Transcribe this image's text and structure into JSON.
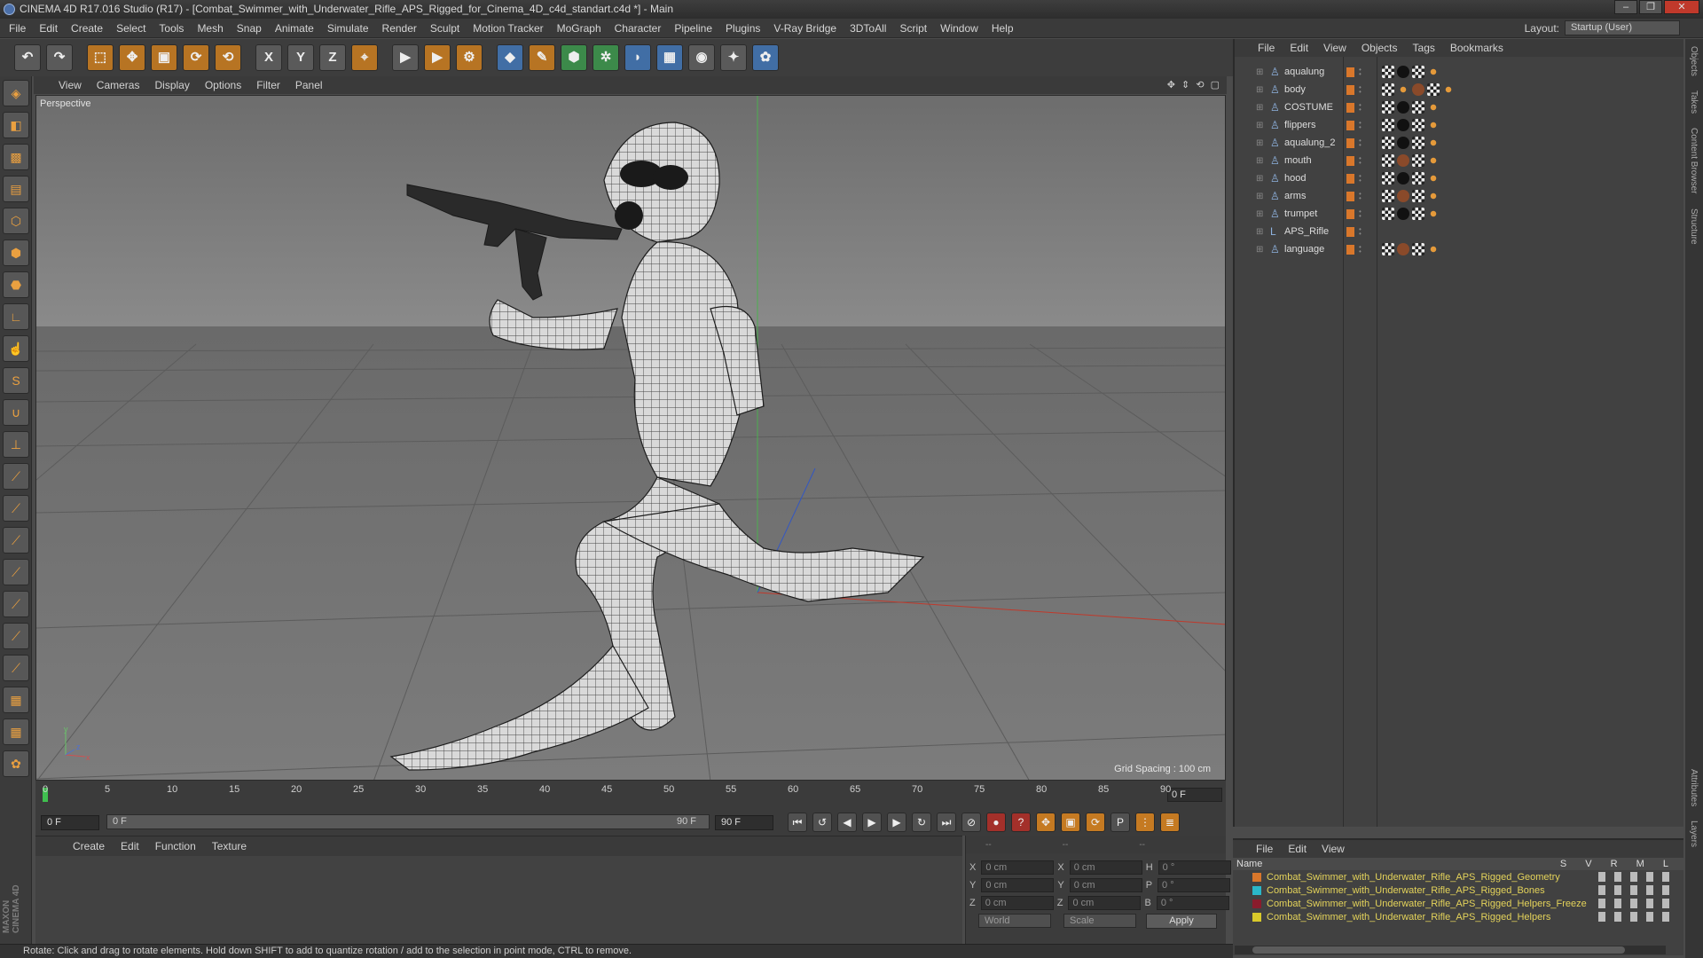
{
  "window": {
    "title": "CINEMA 4D R17.016 Studio (R17) - [Combat_Swimmer_with_Underwater_Rifle_APS_Rigged_for_Cinema_4D_c4d_standart.c4d *] - Main",
    "buttons": [
      "–",
      "❐",
      "✕"
    ]
  },
  "menubar": [
    "File",
    "Edit",
    "Create",
    "Select",
    "Tools",
    "Mesh",
    "Snap",
    "Animate",
    "Simulate",
    "Render",
    "Sculpt",
    "Motion Tracker",
    "MoGraph",
    "Character",
    "Pipeline",
    "Plugins",
    "V-Ray Bridge",
    "3DToAll",
    "Script",
    "Window",
    "Help"
  ],
  "layout": {
    "label": "Layout:",
    "value": "Startup (User)"
  },
  "toolbar": {
    "icons": [
      {
        "name": "undo-icon",
        "glyph": "↶",
        "cls": ""
      },
      {
        "name": "redo-icon",
        "glyph": "↷",
        "cls": ""
      },
      {
        "name": "live-selection-icon",
        "glyph": "⬚",
        "cls": "o sep"
      },
      {
        "name": "move-icon",
        "glyph": "✥",
        "cls": "o"
      },
      {
        "name": "scale-icon",
        "glyph": "▣",
        "cls": "o"
      },
      {
        "name": "rotate-icon",
        "glyph": "⟳",
        "cls": "o"
      },
      {
        "name": "recent-tool-icon",
        "glyph": "⟲",
        "cls": "o"
      },
      {
        "name": "x-axis-icon",
        "glyph": "X",
        "cls": "sep"
      },
      {
        "name": "y-axis-icon",
        "glyph": "Y",
        "cls": ""
      },
      {
        "name": "z-axis-icon",
        "glyph": "Z",
        "cls": ""
      },
      {
        "name": "coordinate-system-icon",
        "glyph": "⌖",
        "cls": "o"
      },
      {
        "name": "render-view-icon",
        "glyph": "▶",
        "cls": "sep"
      },
      {
        "name": "render-picture-viewer-icon",
        "glyph": "▶",
        "cls": "o"
      },
      {
        "name": "render-settings-icon",
        "glyph": "⚙",
        "cls": "o"
      },
      {
        "name": "cube-icon",
        "glyph": "◆",
        "cls": "b sep"
      },
      {
        "name": "pen-spline-icon",
        "glyph": "✎",
        "cls": "o"
      },
      {
        "name": "subdivision-icon",
        "glyph": "⬢",
        "cls": "g"
      },
      {
        "name": "array-icon",
        "glyph": "✲",
        "cls": "g"
      },
      {
        "name": "deformer-icon",
        "glyph": "◗",
        "cls": "b"
      },
      {
        "name": "floor-icon",
        "glyph": "▦",
        "cls": "b"
      },
      {
        "name": "camera-icon",
        "glyph": "◉",
        "cls": ""
      },
      {
        "name": "light-icon",
        "glyph": "✦",
        "cls": ""
      },
      {
        "name": "python-icon",
        "glyph": "✿",
        "cls": "b"
      }
    ]
  },
  "lefttools": [
    {
      "name": "model-mode-icon",
      "glyph": "◈"
    },
    {
      "name": "object-mode-icon",
      "glyph": "◧"
    },
    {
      "name": "texture-mode-icon",
      "glyph": "▩"
    },
    {
      "name": "workplane-icon",
      "glyph": "▤"
    },
    {
      "name": "points-mode-icon",
      "glyph": "⬡"
    },
    {
      "name": "edges-mode-icon",
      "glyph": "⬢"
    },
    {
      "name": "polygons-mode-icon",
      "glyph": "⬣"
    },
    {
      "name": "axis-mode-icon",
      "glyph": "∟"
    },
    {
      "name": "tweak-mode-icon",
      "glyph": "☝"
    },
    {
      "name": "snap-icon",
      "glyph": "S"
    },
    {
      "name": "magnet-icon",
      "glyph": "∪"
    },
    {
      "name": "joint-icon",
      "glyph": "⊥"
    },
    {
      "name": "brush-1-icon",
      "glyph": "⟋"
    },
    {
      "name": "brush-2-icon",
      "glyph": "⟋"
    },
    {
      "name": "brush-3-icon",
      "glyph": "⟋"
    },
    {
      "name": "brush-4-icon",
      "glyph": "⟋"
    },
    {
      "name": "brush-5-icon",
      "glyph": "⟋"
    },
    {
      "name": "brush-6-icon",
      "glyph": "⟋"
    },
    {
      "name": "brush-7-icon",
      "glyph": "⟋"
    },
    {
      "name": "layer-grid-icon",
      "glyph": "▦"
    },
    {
      "name": "layer-lock-icon",
      "glyph": "▦"
    },
    {
      "name": "python-script-icon",
      "glyph": "✿"
    }
  ],
  "brand": "MAXON CINEMA 4D",
  "viewport": {
    "menu": [
      "View",
      "Cameras",
      "Display",
      "Options",
      "Filter",
      "Panel"
    ],
    "nav_icons": "✥ ⇕ ⟲ ▢",
    "label": "Perspective",
    "grid_spacing": "Grid Spacing : 100 cm",
    "gizmo": {
      "y": "y",
      "x": "x",
      "z": "z"
    }
  },
  "timeline": {
    "ticks": [
      "0",
      "5",
      "10",
      "15",
      "20",
      "25",
      "30",
      "35",
      "40",
      "45",
      "50",
      "55",
      "60",
      "65",
      "70",
      "75",
      "80",
      "85",
      "90"
    ],
    "current_frame": "0 F",
    "end_field": "0 F"
  },
  "playback": {
    "start": "0 F",
    "range_start": "0 F",
    "range_end": "90 F",
    "end": "90 F",
    "buttons": [
      {
        "name": "go-to-start-icon",
        "glyph": "⏮",
        "cls": ""
      },
      {
        "name": "previous-key-icon",
        "glyph": "↺",
        "cls": ""
      },
      {
        "name": "previous-frame-icon",
        "glyph": "◀",
        "cls": ""
      },
      {
        "name": "play-icon",
        "glyph": "▶",
        "cls": ""
      },
      {
        "name": "next-frame-icon",
        "glyph": "▶",
        "cls": ""
      },
      {
        "name": "next-key-icon",
        "glyph": "↻",
        "cls": ""
      },
      {
        "name": "go-to-end-icon",
        "glyph": "⏭",
        "cls": ""
      },
      {
        "name": "record-off-icon",
        "glyph": "⊘",
        "cls": ""
      },
      {
        "name": "record-icon",
        "glyph": "●",
        "cls": "red"
      },
      {
        "name": "auto-key-icon",
        "glyph": "?",
        "cls": "red"
      },
      {
        "name": "key-move-icon",
        "glyph": "✥",
        "cls": "or"
      },
      {
        "name": "key-scale-icon",
        "glyph": "▣",
        "cls": "or"
      },
      {
        "name": "key-rotate-icon",
        "glyph": "⟳",
        "cls": "or"
      },
      {
        "name": "key-param-icon",
        "glyph": "P",
        "cls": ""
      },
      {
        "name": "key-pla-icon",
        "glyph": "⋮",
        "cls": "or"
      },
      {
        "name": "timeline-icon",
        "glyph": "≣",
        "cls": "or"
      }
    ]
  },
  "material_manager": {
    "menu": [
      "Create",
      "Edit",
      "Function",
      "Texture"
    ]
  },
  "coordinates": {
    "headers": [
      "--",
      "--",
      "--"
    ],
    "rows": [
      {
        "axis": "X",
        "pos": "0 cm",
        "sx": "X",
        "size": "0 cm",
        "rl": "H",
        "rot": "0 °"
      },
      {
        "axis": "Y",
        "pos": "0 cm",
        "sx": "Y",
        "size": "0 cm",
        "rl": "P",
        "rot": "0 °"
      },
      {
        "axis": "Z",
        "pos": "0 cm",
        "sx": "Z",
        "size": "0 cm",
        "rl": "B",
        "rot": "0 °"
      }
    ],
    "mode": "World",
    "scale": "Scale",
    "apply": "Apply"
  },
  "status": "Rotate: Click and drag to rotate elements. Hold down SHIFT to add to quantize rotation / add to the selection in point mode, CTRL to remove.",
  "object_manager": {
    "menu": [
      "File",
      "Edit",
      "View",
      "Objects",
      "Tags",
      "Bookmarks"
    ],
    "objects": [
      {
        "name": "aqualung",
        "tags": [
          "chk",
          "blk",
          "chk",
          "org"
        ]
      },
      {
        "name": "body",
        "tags": [
          "chk",
          "bone",
          "brn",
          "chk",
          "org"
        ]
      },
      {
        "name": "COSTUME",
        "tags": [
          "chk",
          "blk",
          "chk",
          "org"
        ]
      },
      {
        "name": "flippers",
        "tags": [
          "chk",
          "blk",
          "chk",
          "org"
        ]
      },
      {
        "name": "aqualung_2",
        "tags": [
          "chk",
          "blk",
          "chk",
          "org"
        ]
      },
      {
        "name": "mouth",
        "tags": [
          "chk",
          "brn",
          "chk",
          "org"
        ]
      },
      {
        "name": "hood",
        "tags": [
          "chk",
          "blk",
          "chk",
          "org"
        ]
      },
      {
        "name": "arms",
        "tags": [
          "chk",
          "brn",
          "chk",
          "org"
        ]
      },
      {
        "name": "trumpet",
        "tags": [
          "chk",
          "blk",
          "chk",
          "org"
        ]
      },
      {
        "name": "APS_Rifle",
        "tags": []
      },
      {
        "name": "language",
        "tags": [
          "chk",
          "brn",
          "chk",
          "org"
        ]
      }
    ]
  },
  "side_tabs": [
    "Objects",
    "Takes",
    "Content Browser",
    "Structure"
  ],
  "side_tabs_bottom": [
    "Attributes",
    "Layers"
  ],
  "layer_manager": {
    "menu": [
      "File",
      "Edit",
      "View"
    ],
    "header": "Name",
    "flags": "S V R M L",
    "layers": [
      {
        "name": "Combat_Swimmer_with_Underwater_Rifle_APS_Rigged_Geometry",
        "color": "#d9772b"
      },
      {
        "name": "Combat_Swimmer_with_Underwater_Rifle_APS_Rigged_Bones",
        "color": "#2ab7c9"
      },
      {
        "name": "Combat_Swimmer_with_Underwater_Rifle_APS_Rigged_Helpers_Freeze",
        "color": "#8a1c2c"
      },
      {
        "name": "Combat_Swimmer_with_Underwater_Rifle_APS_Rigged_Helpers",
        "color": "#d8c92a"
      }
    ]
  }
}
